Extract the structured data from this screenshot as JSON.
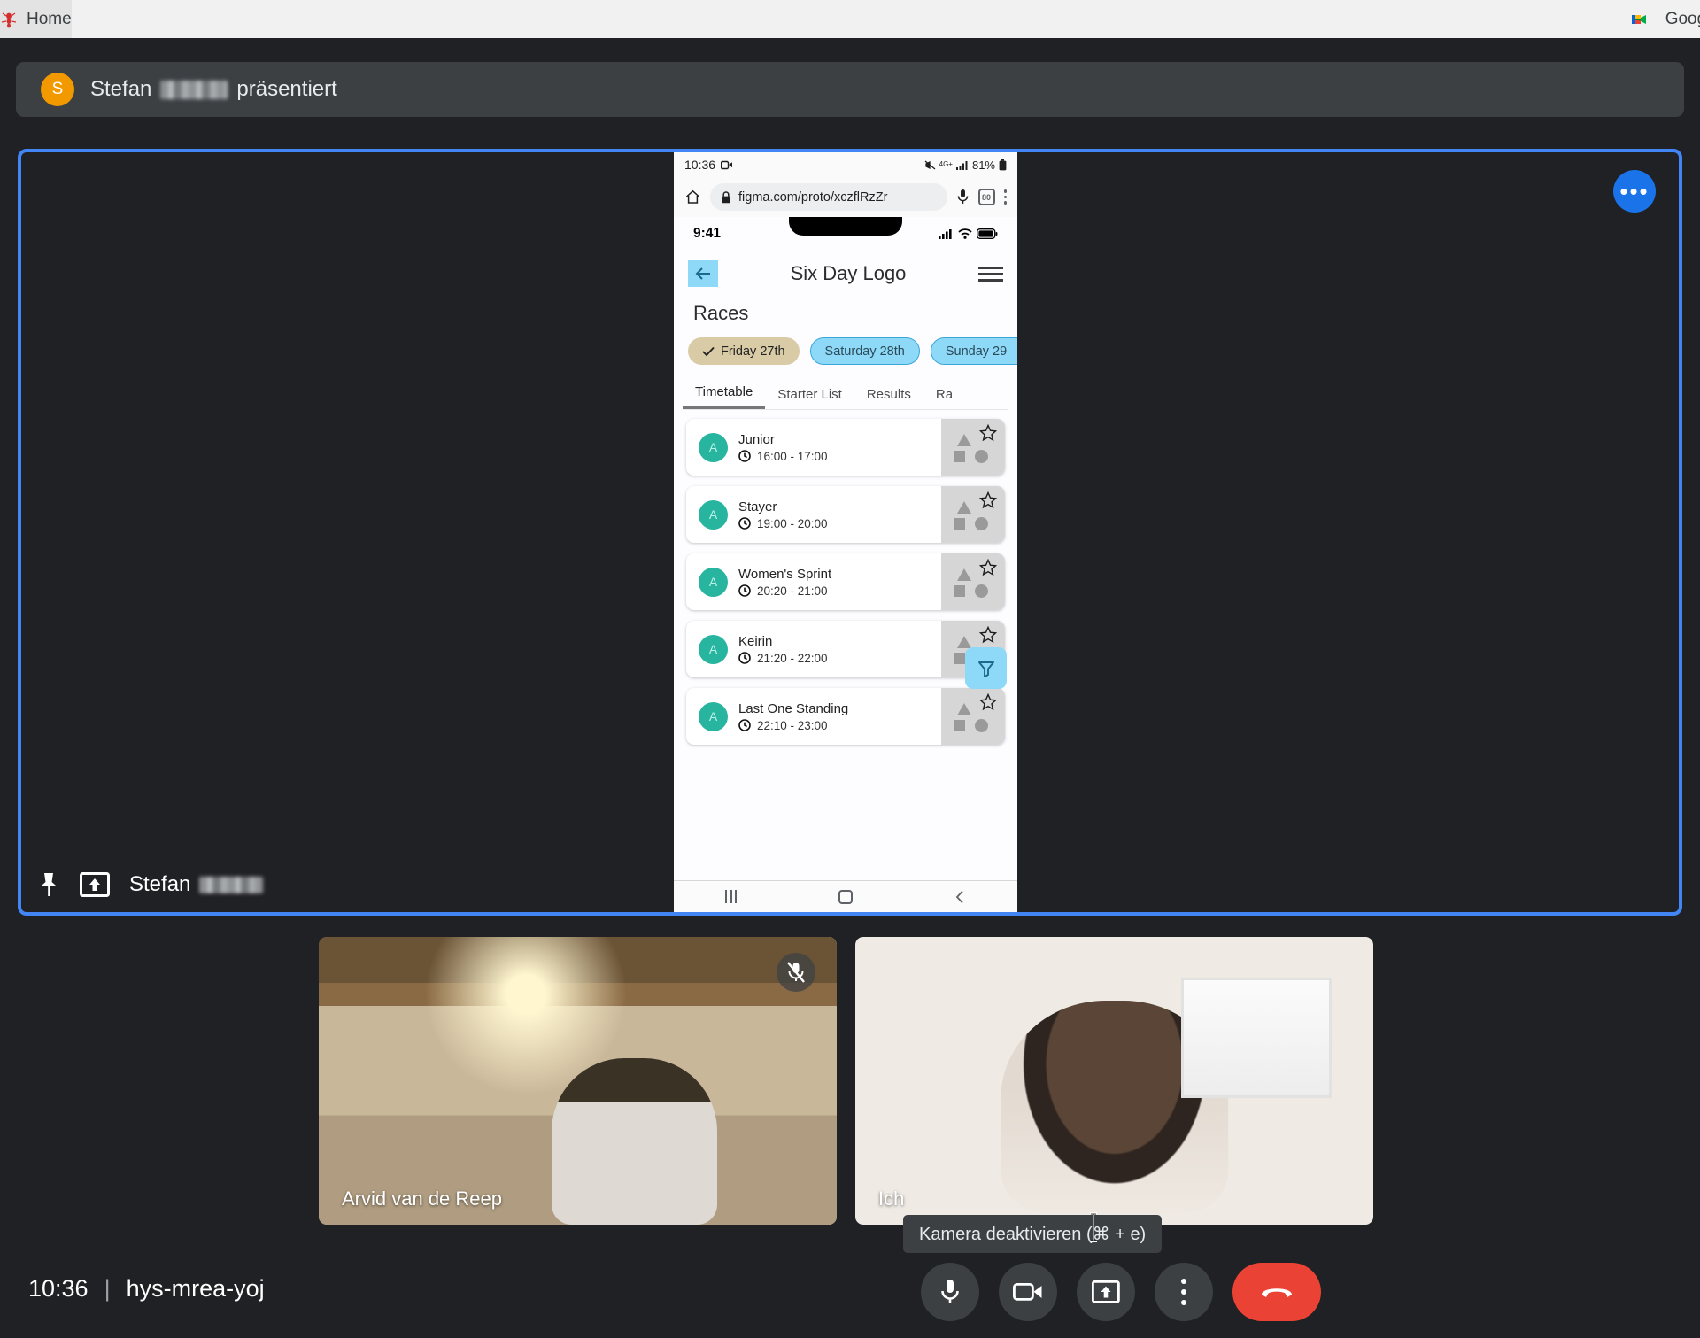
{
  "browser": {
    "tabs": [
      {
        "title": "Home",
        "favicon": "ant-icon",
        "active": true
      },
      {
        "title": "Google Meet",
        "favicon": "google-meet-icon",
        "active": false
      }
    ]
  },
  "banner": {
    "avatar_initial": "S",
    "avatar_color": "#f29900",
    "name_prefix": "Stefan",
    "text_suffix": "präsentiert"
  },
  "stage": {
    "more_options_label": "•••",
    "presenter_name": "Stefan",
    "icons": {
      "pin": "pin-icon",
      "present": "present-screen-icon"
    }
  },
  "phone": {
    "android_status": {
      "time": "10:36",
      "camera_icon": "camera-recording-icon",
      "network": "4G+",
      "battery": "81%"
    },
    "chrome": {
      "url": "figma.com/proto/xczflRzZr",
      "tab_count": "80",
      "icons": [
        "home-icon",
        "lock-icon",
        "microphone-icon",
        "tab-count-icon",
        "overflow-menu-icon"
      ]
    },
    "ios_status": {
      "time": "9:41",
      "icons": [
        "cellular-icon",
        "wifi-icon",
        "battery-icon"
      ]
    },
    "proto": {
      "title": "Six Day Logo",
      "page_heading": "Races",
      "back_icon": "back-arrow-icon",
      "menu_icon": "hamburger-menu-icon",
      "day_chips": [
        {
          "label": "Friday 27th",
          "state": "selected"
        },
        {
          "label": "Saturday 28th",
          "state": "hotspot"
        },
        {
          "label": "Sunday 29",
          "state": "hotspot"
        }
      ],
      "tabs": [
        {
          "label": "Timetable",
          "active": true
        },
        {
          "label": "Starter List",
          "active": false
        },
        {
          "label": "Results",
          "active": false
        },
        {
          "label": "Ra",
          "active": false
        }
      ],
      "races": [
        {
          "avatar": "A",
          "name": "Junior",
          "time": "16:00 - 17:00"
        },
        {
          "avatar": "A",
          "name": "Stayer",
          "time": "19:00 - 20:00"
        },
        {
          "avatar": "A",
          "name": "Women's Sprint",
          "time": "20:20 - 21:00"
        },
        {
          "avatar": "A",
          "name": "Keirin",
          "time": "21:20 - 22:00"
        },
        {
          "avatar": "A",
          "name": "Last One Standing",
          "time": "22:10 - 23:00"
        }
      ],
      "filter_button_icon": "filter-funnel-icon"
    },
    "android_nav": [
      "recents-icon",
      "home-icon",
      "back-icon"
    ]
  },
  "participants": [
    {
      "name": "Arvid van de Reep",
      "muted": true
    },
    {
      "name": "Ich",
      "muted": false
    }
  ],
  "footer": {
    "time": "10:36",
    "separator": "|",
    "meeting_code": "hys-mrea-yoj",
    "tooltip": "Kamera deaktivieren (⌘ + e)",
    "controls": [
      {
        "name": "microphone-button",
        "icon": "microphone-icon"
      },
      {
        "name": "camera-button",
        "icon": "video-camera-icon"
      },
      {
        "name": "present-button",
        "icon": "present-screen-icon"
      },
      {
        "name": "more-options-button",
        "icon": "more-vertical-icon"
      },
      {
        "name": "leave-call-button",
        "icon": "phone-hangup-icon"
      }
    ]
  },
  "colors": {
    "accent_blue": "#4285f4",
    "end_red": "#ea4335",
    "chip_selected": "#d9cba6",
    "hotspot_blue": "#8ed8f8",
    "avatar_teal": "#27b5a0"
  }
}
